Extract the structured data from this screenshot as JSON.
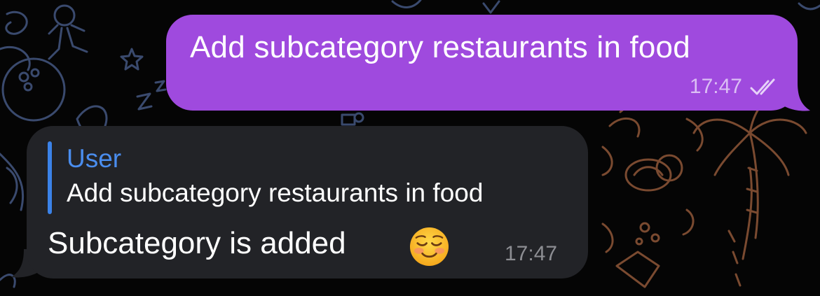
{
  "chat": {
    "outgoing": {
      "text": "Add subcategory restaurants in food",
      "time": "17:47",
      "status_icon": "double-check-icon",
      "bubble_color": "#9f4ade"
    },
    "incoming": {
      "reply_to": {
        "sender": "User",
        "text": "Add subcategory restaurants in food"
      },
      "text": "Subcategory is added",
      "emoji_icon": "smiling-face-icon",
      "time": "17:47",
      "bubble_color": "#222327",
      "reply_accent": "#3b82e8"
    }
  }
}
